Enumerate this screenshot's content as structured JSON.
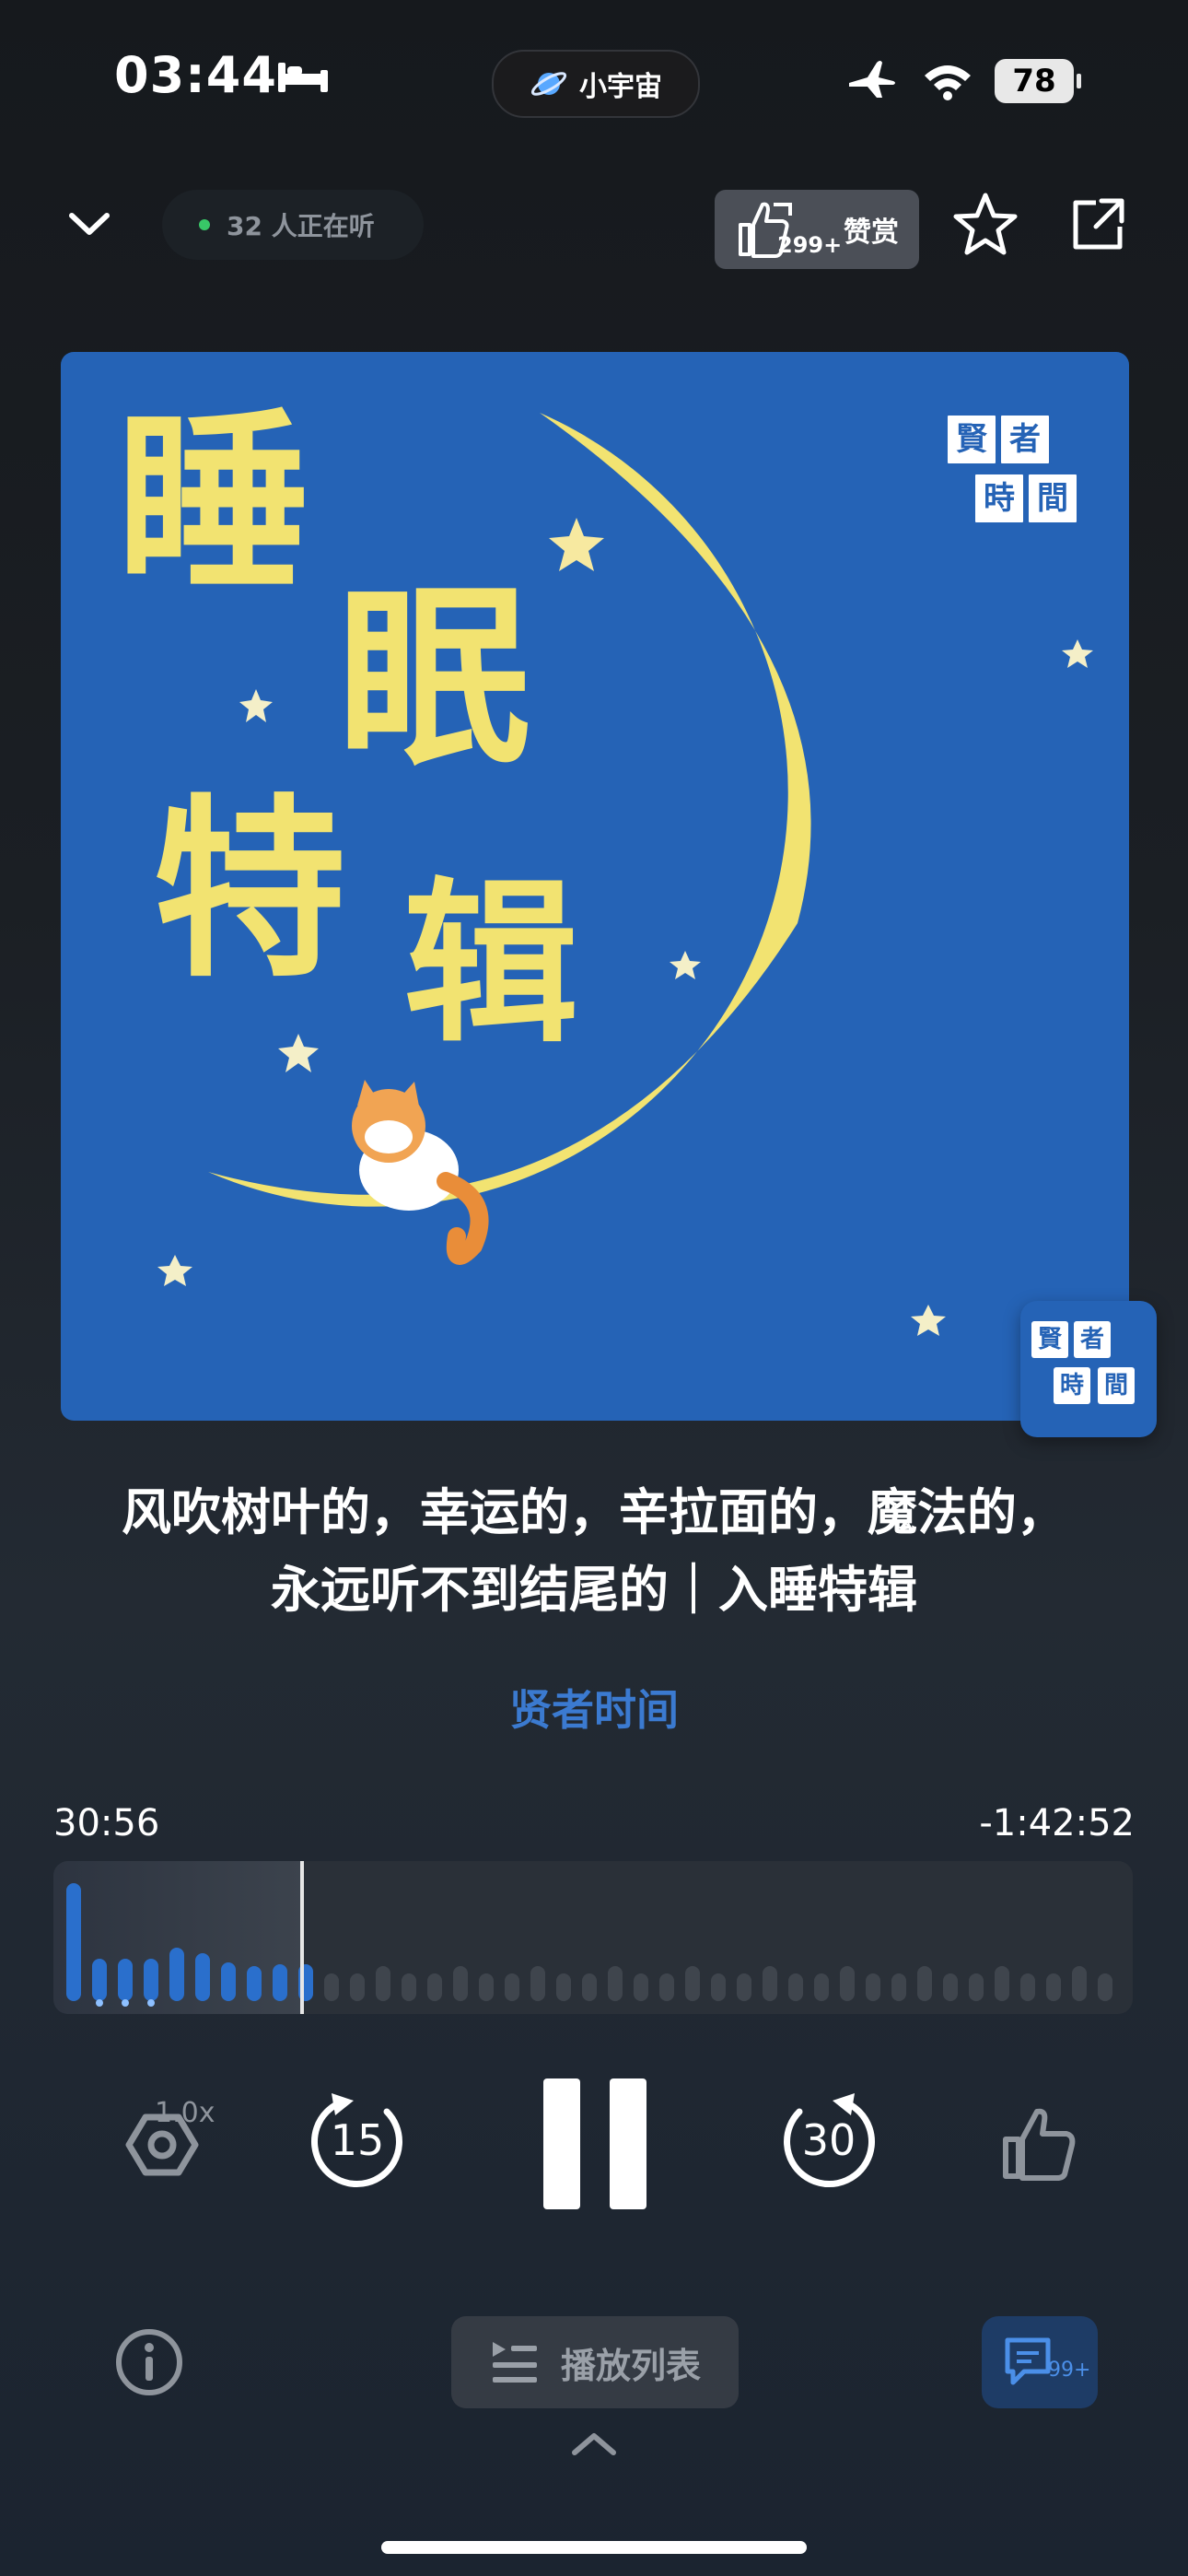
{
  "status_bar": {
    "time": "03:44",
    "center_pill": "小宇宙",
    "battery": "78",
    "icons": [
      "bed-icon",
      "planet-icon",
      "airplane-icon",
      "wifi-icon",
      "battery-icon"
    ]
  },
  "top_bar": {
    "listeners": "32 人正在听",
    "reward_count": "299+",
    "reward_label": "赞赏",
    "icons": [
      "chevron-down-icon",
      "thumb-icon",
      "star-icon",
      "share-icon"
    ]
  },
  "artwork": {
    "title_chars": [
      "睡",
      "眠",
      "特",
      "辑"
    ],
    "logo_chars": [
      "賢",
      "者",
      "時",
      "間"
    ]
  },
  "episode": {
    "title": "风吹树叶的，幸运的，辛拉面的，魔法的，永远听不到结尾的｜入睡特辑",
    "podcast": "贤者时间"
  },
  "progress": {
    "elapsed": "30:56",
    "remaining": "-1:42:52",
    "played_fraction": 0.23
  },
  "controls": {
    "speed": "1.0x",
    "rewind": "15",
    "forward": "30"
  },
  "bottom": {
    "playlist_label": "播放列表",
    "comment_count": "99+"
  },
  "colors": {
    "accent": "#2563b6",
    "author": "#3b7ad0",
    "moon": "#f2e371"
  }
}
